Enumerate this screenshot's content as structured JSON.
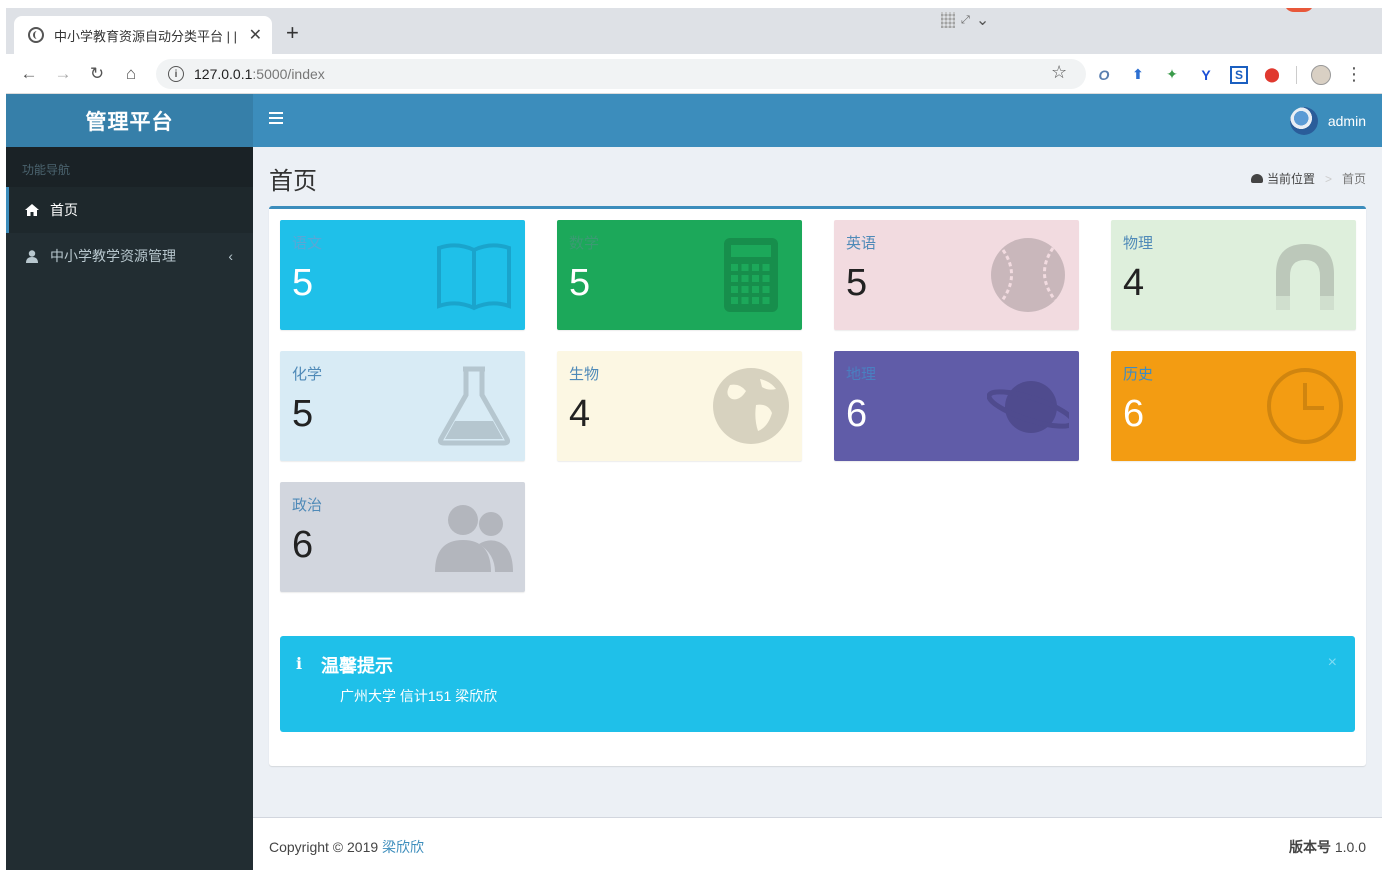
{
  "browser": {
    "tab_title": "中小学教育资源自动分类平台 | |",
    "url_host": "127.0.0.1",
    "url_path": ":5000/index"
  },
  "app": {
    "logo": "管理平台",
    "user_name": "admin"
  },
  "sidebar": {
    "header": "功能导航",
    "items": [
      {
        "label": "首页",
        "icon": "home-icon"
      },
      {
        "label": "中小学教学资源管理",
        "icon": "user-icon"
      }
    ]
  },
  "content": {
    "title": "首页",
    "breadcrumb": {
      "root": "当前位置",
      "sep": ">",
      "current": "首页"
    }
  },
  "tiles": [
    {
      "label": "语文",
      "value": "5",
      "icon": "book-icon",
      "bg": "#1fc0e9",
      "label_color": "#59a7d6",
      "value_color": "#ffffff",
      "icon_color": "#1aa4cc"
    },
    {
      "label": "数学",
      "value": "5",
      "icon": "calculator-icon",
      "bg": "#1ca85a",
      "label_color": "#3b9a73",
      "value_color": "#ffffff",
      "icon_color": "#178e4c"
    },
    {
      "label": "英语",
      "value": "5",
      "icon": "baseball-icon",
      "bg": "#f2dbe0",
      "label_color": "#4f8ab8",
      "value_color": "#222222",
      "icon_color": "#c9b7bb"
    },
    {
      "label": "物理",
      "value": "4",
      "icon": "magnet-icon",
      "bg": "#deefdc",
      "label_color": "#4f8ab8",
      "value_color": "#222222",
      "icon_color": "#bcc8ba"
    },
    {
      "label": "化学",
      "value": "5",
      "icon": "flask-icon",
      "bg": "#d8ebf5",
      "label_color": "#4f8ab8",
      "value_color": "#222222",
      "icon_color": "#b5c6cf"
    },
    {
      "label": "生物",
      "value": "4",
      "icon": "globe-icon",
      "bg": "#fcf7e3",
      "label_color": "#4f8ab8",
      "value_color": "#222222",
      "icon_color": "#d7d2bf"
    },
    {
      "label": "地理",
      "value": "6",
      "icon": "planet-icon",
      "bg": "#605ca8",
      "label_color": "#4a7fc0",
      "value_color": "#ffffff",
      "icon_color": "#4f4b8e"
    },
    {
      "label": "历史",
      "value": "6",
      "icon": "clock-icon",
      "bg": "#f39c12",
      "label_color": "#3d8cc4",
      "value_color": "#ffffff",
      "icon_color": "#d0850f"
    },
    {
      "label": "政治",
      "value": "6",
      "icon": "users-icon",
      "bg": "#d2d6de",
      "label_color": "#4f8ab8",
      "value_color": "#222222",
      "icon_color": "#b3b6bd"
    }
  ],
  "callout": {
    "icon": "i",
    "title": "温馨提示",
    "text": "广州大学 信计151 梁欣欣",
    "close": "×"
  },
  "footer": {
    "copyright_prefix": "Copyright © 2019",
    "copyright_link": "梁欣欣",
    "version_label": "版本号",
    "version": "1.0.0"
  },
  "colors": {
    "topbar": "#3c8dbc",
    "logo": "#367fa9",
    "sidebar": "#222d32"
  }
}
